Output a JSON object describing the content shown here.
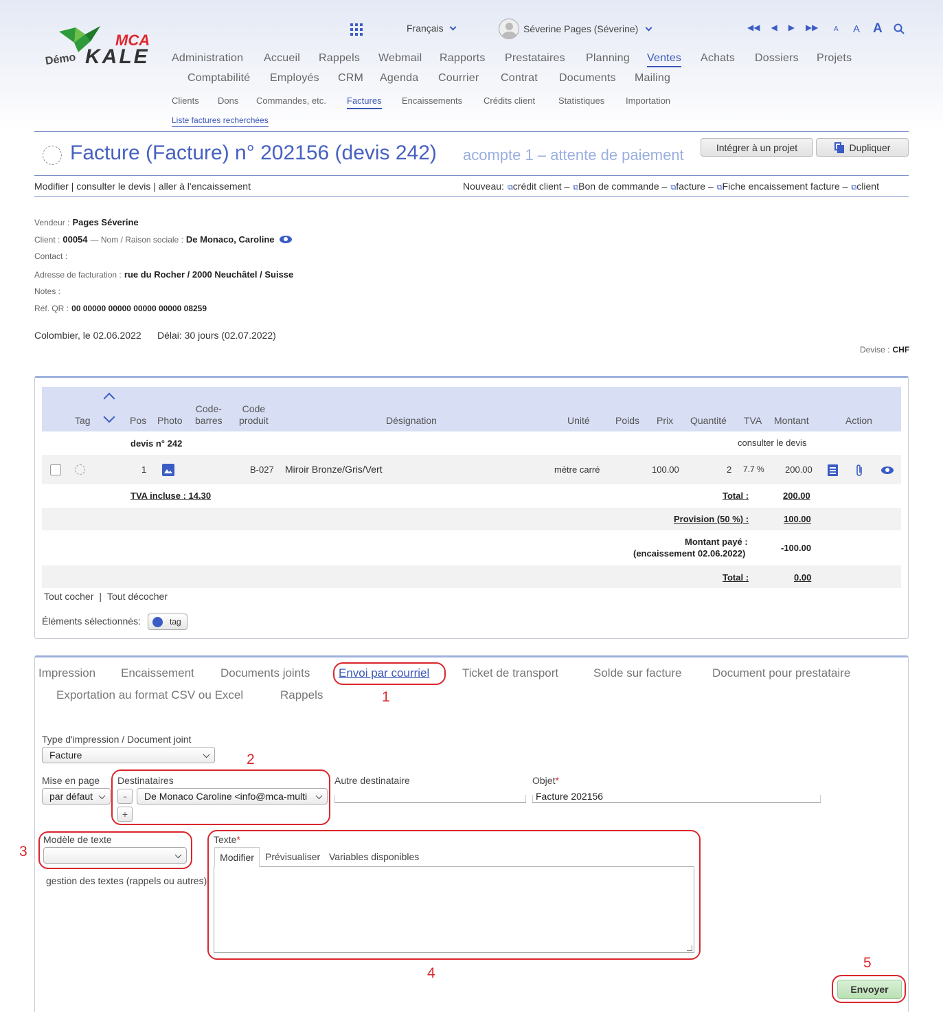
{
  "header": {
    "logo": {
      "demo": "Démo",
      "mca": "MCA",
      "kale": "KALE"
    },
    "language": "Français",
    "user": "Séverine Pages (Séverine)",
    "font_sizes": [
      "A",
      "A",
      "A"
    ],
    "main_nav": [
      "Administration",
      "Accueil",
      "Rappels",
      "Webmail",
      "Rapports",
      "Prestataires",
      "Planning",
      "Ventes",
      "Achats",
      "Dossiers",
      "Projets",
      "Comptabilité",
      "Employés",
      "CRM",
      "Agenda",
      "Courrier",
      "Contrat",
      "Documents",
      "Mailing"
    ],
    "sub_nav": [
      "Clients",
      "Dons",
      "Commandes, etc.",
      "Factures",
      "Encaissements",
      "Crédits client",
      "Statistiques",
      "Importation"
    ],
    "search_link": "Liste factures recherchées"
  },
  "invoice": {
    "title": "Facture (Facture) n° 202156 (devis 242)",
    "status": "acompte 1 – attente de paiement",
    "btn_project": "Intégrer à un projet",
    "btn_duplicate": "Dupliquer",
    "actions_left": "Modifier | consulter le devis | aller à l'encaissement",
    "nouveau_label": "Nouveau:",
    "nouveau_links": [
      "crédit client –",
      "Bon de commande –",
      "facture –",
      "Fiche encaissement facture –",
      "client"
    ],
    "vendeur_lbl": "Vendeur :",
    "vendeur": "Pages Séverine",
    "client_lbl": "Client :",
    "client_no": "00054",
    "nom_lbl": "— Nom / Raison sociale :",
    "client_name": "De Monaco, Caroline",
    "contact_lbl": "Contact :",
    "adresse_lbl": "Adresse de facturation :",
    "adresse": "rue du Rocher / 2000 Neuchâtel / Suisse",
    "notes_lbl": "Notes :",
    "qr_lbl": "Réf. QR :",
    "qr": "00 00000 00000 00000 00000 08259",
    "place_date": "Colombier, le 02.06.2022",
    "delai": "Délai: 30 jours (02.07.2022)",
    "devise_lbl": "Devise :",
    "devise": "CHF"
  },
  "table": {
    "headers": {
      "tag": "Tag",
      "pos": "Pos",
      "photo": "Photo",
      "barcode": "Code-\nbarres",
      "code": "Code\nproduit",
      "designation": "Désignation",
      "unite": "Unité",
      "poids": "Poids",
      "prix": "Prix",
      "quantite": "Quantité",
      "tva": "TVA",
      "montant": "Montant",
      "action": "Action"
    },
    "group_label": "devis n° 242",
    "group_link": "consulter le devis",
    "row": {
      "pos": "1",
      "code": "B-027",
      "designation": "Miroir Bronze/Gris/Vert",
      "unite": "mètre carré",
      "prix": "100.00",
      "quantite": "2",
      "tva": "7.7 %",
      "montant": "200.00"
    },
    "tva_incluse": "TVA incluse : 14.30",
    "total_lbl": "Total :",
    "total": "200.00",
    "provision_lbl": "Provision (50 %) :",
    "provision": "100.00",
    "paye_lbl1": "Montant payé :",
    "paye_lbl2": "(encaissement 02.06.2022)",
    "paye": "-100.00",
    "total2_lbl": "Total :",
    "total2": "0.00",
    "check_all": "Tout cocher",
    "uncheck_all": "Tout décocher",
    "selected_lbl": "Éléments sélectionnés:",
    "tag_btn": "tag"
  },
  "tabs": [
    "Impression",
    "Encaissement",
    "Documents joints",
    "Envoi par courriel",
    "Ticket de transport",
    "Solde sur facture",
    "Document pour prestataire",
    "Exportation au format CSV ou Excel",
    "Rappels"
  ],
  "form": {
    "type_lbl": "Type d'impression / Document joint",
    "type_val": "Facture",
    "mise_lbl": "Mise en page",
    "mise_val": "par défaut",
    "dest_lbl": "Destinataires",
    "dest_val": "De Monaco Caroline <info@mca-multi",
    "minus": "–",
    "plus": "+",
    "autre_lbl": "Autre destinataire",
    "objet_lbl": "Objet",
    "objet_val": "Facture 202156",
    "modele_lbl": "Modèle de texte",
    "modele_val": "",
    "gestion": "gestion des textes (rappels ou autres)",
    "texte_lbl": "Texte",
    "texte_tabs": [
      "Modifier",
      "Prévisualiser",
      "Variables disponibles"
    ],
    "send": "Envoyer",
    "req": "*"
  },
  "annotations": [
    "1",
    "2",
    "3",
    "4",
    "5"
  ]
}
